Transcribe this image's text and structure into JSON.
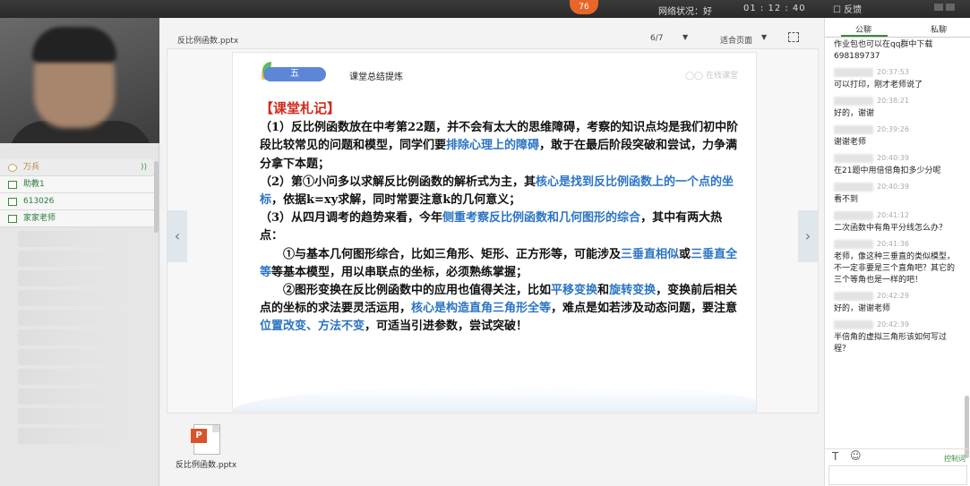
{
  "topbar": {
    "online_count": "76",
    "network_status": "网络状况：好",
    "timer": "01 : 12 : 40",
    "feedback": "反馈"
  },
  "sidebar": {
    "members": [
      {
        "label": "万兵",
        "role": "teacher"
      },
      {
        "label": "助教1",
        "role": "assistant"
      },
      {
        "label": "613026",
        "role": "assistant"
      },
      {
        "label": "家家老师",
        "role": "assistant"
      }
    ]
  },
  "document": {
    "file_name": "反比例函数.pptx",
    "page_indicator": "6/7",
    "fit_mode": "适合页面",
    "prev_icon": "chevron-left-icon",
    "next_icon": "chevron-right-icon"
  },
  "slide": {
    "section_number": "五",
    "section_title": "课堂总结提炼",
    "heading": "【课堂札记】",
    "p1a": "（1）反比例函数放在中考第22题，并不会有太大的思维障碍，考察的知识点均是我们初中阶段比较常见的问题和模型，同学们要",
    "p1b": "排除心理上的障碍",
    "p1c": "，敢于在最后阶段突破和尝试，力争满分拿下本题；",
    "p2a": "（2）第①小问多以求解反比例函数的解析式为主，其",
    "p2b": "核心是找到反比例函数上的一个点的坐标",
    "p2c": "，依据k=xy求解，同时常要注意k的几何意义；",
    "p3a": "（3）从四月调考的趋势来看，今年",
    "p3b": "侧重考察反比例函数和几何图形的综合",
    "p3c": "，其中有两大热点：",
    "p4a": "①与基本几何图形综合，比如三角形、矩形、正方形等，可能涉及",
    "p4b": "三垂直相似",
    "p4c": "或",
    "p4d": "三垂直全等",
    "p4e": "等基本模型，用以串联点的坐标，必须熟练掌握；",
    "p5a": "②图形变换在反比例函数中的应用也值得关注，比如",
    "p5b": "平移变换",
    "p5c": "和",
    "p5d": "旋转变换",
    "p5e": "，变换前后相关点的坐标的求法要灵活运用，",
    "p5f": "核心是构造直角三角形全等",
    "p5g": "，难点是如若涉及动态问题，要注意",
    "p5h": "位置改变、方法不变",
    "p5i": "，可适当引进参数，尝试突破！"
  },
  "attachments": {
    "file_name": "反比例函数.pptx"
  },
  "chat": {
    "tab_public": "公聊",
    "tab_private": "私聊",
    "messages": [
      {
        "time": "",
        "text": "作业包也可以在qq群中下载698189737"
      },
      {
        "time": "20:37:53",
        "text": "可以打印，刚才老师说了"
      },
      {
        "time": "20:38:21",
        "text": "好的，谢谢"
      },
      {
        "time": "20:39:26",
        "text": "谢谢老师"
      },
      {
        "time": "20:40:39",
        "text": "在21题中用倍倍角扣多少分呢"
      },
      {
        "time": "20:40:39",
        "text": "看不到"
      },
      {
        "time": "20:41:12",
        "text": "二次函数中有角平分线怎么办？"
      },
      {
        "time": "20:41:36",
        "text": "老师，像这种三垂直的类似模型，不一定非要是三个直角吧？其它的三个等角也是一样的吧！"
      },
      {
        "time": "20:42:29",
        "text": "好的，谢谢老师"
      },
      {
        "time": "20:42:39",
        "text": "半倍角的虚拟三角形该如何写过程？"
      }
    ],
    "control_label": "控制词"
  }
}
